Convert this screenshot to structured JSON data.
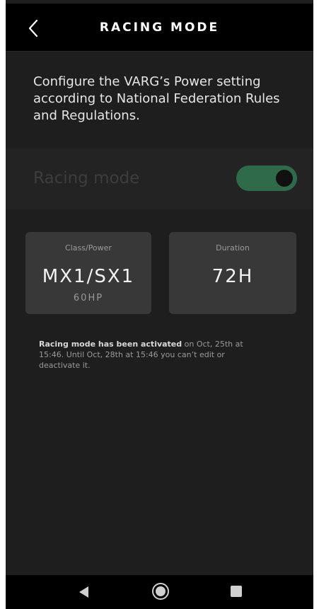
{
  "header": {
    "title": "RACING MODE",
    "back_icon": "chevron-left-icon"
  },
  "intro": {
    "text": "Configure the VARG’s Power setting according to National Federation Rules and Regulations."
  },
  "racing_mode": {
    "label": "Racing mode",
    "toggle_on": true,
    "toggle_color": "#2f6b4b"
  },
  "cards": {
    "class_power": {
      "label": "Class/Power",
      "value": "MX1/SX1",
      "sub": "60HP"
    },
    "duration": {
      "label": "Duration",
      "value": "72H"
    }
  },
  "info": {
    "bold": "Racing mode has been activated",
    "rest": " on Oct, 25th at 15:46. Until Oct, 28th at 15:46 you can’t edit or deactivate it."
  },
  "nav": {
    "back_icon": "triangle-back-icon",
    "home_icon": "circle-home-icon",
    "recents_icon": "square-recents-icon"
  }
}
